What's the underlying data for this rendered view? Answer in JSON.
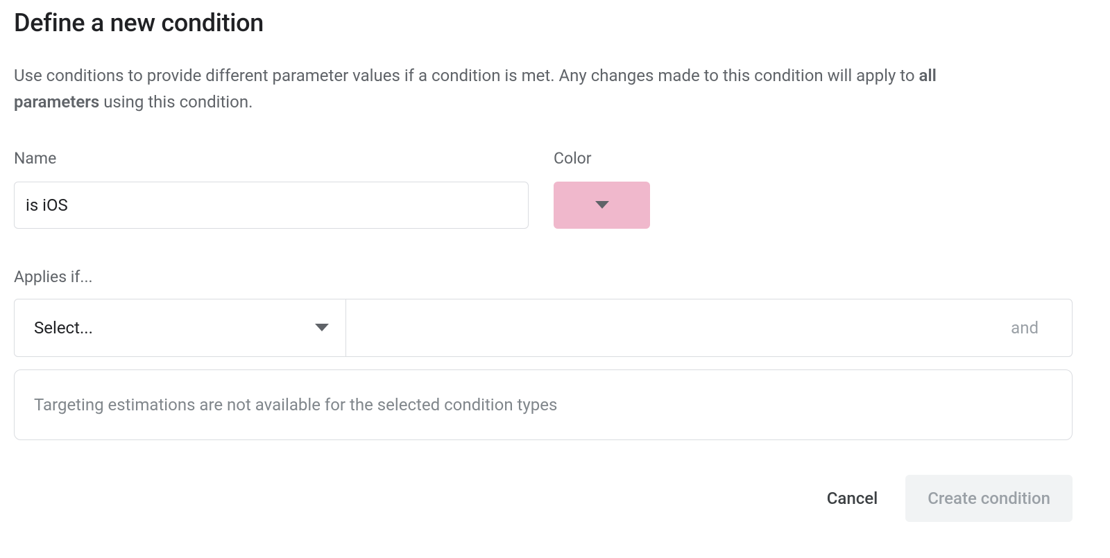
{
  "heading": "Define a new condition",
  "description": {
    "pre": "Use conditions to provide different parameter values if a condition is met. Any changes made to this condition will apply to ",
    "bold": "all parameters",
    "post": " using this condition."
  },
  "fields": {
    "name_label": "Name",
    "name_value": "is iOS",
    "color_label": "Color",
    "color_value": "#f0b8cc"
  },
  "applies": {
    "label": "Applies if...",
    "select_placeholder": "Select...",
    "and_label": "and"
  },
  "estimation": {
    "message": "Targeting estimations are not available for the selected condition types"
  },
  "buttons": {
    "cancel": "Cancel",
    "create": "Create condition"
  }
}
